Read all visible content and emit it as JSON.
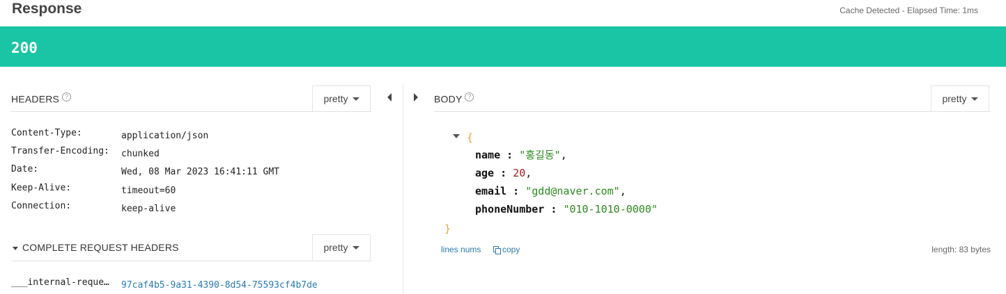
{
  "top": {
    "title": "Response",
    "cache_info": "Cache Detected - Elapsed Time: 1ms"
  },
  "status": {
    "code": "200",
    "color": "#19c5a4"
  },
  "headers_panel": {
    "title": "HEADERS",
    "help_icon": "?",
    "format_label": "pretty",
    "rows": [
      {
        "key": "Content-Type:",
        "value": "application/json"
      },
      {
        "key": "Transfer-Encoding:",
        "value": "chunked"
      },
      {
        "key": "Date:",
        "value": "Wed, 08 Mar 2023 16:41:11 GMT"
      },
      {
        "key": "Keep-Alive:",
        "value": "timeout=60"
      },
      {
        "key": "Connection:",
        "value": "keep-alive"
      }
    ]
  },
  "request_headers_panel": {
    "title": "COMPLETE REQUEST HEADERS",
    "format_label": "pretty",
    "rows": [
      {
        "key": "___internal-reque…",
        "value": "97caf4b5-9a31-4390-8d54-75593cf4b7de"
      }
    ]
  },
  "body_panel": {
    "title": "BODY",
    "help_icon": "?",
    "format_label": "pretty",
    "json": {
      "open_brace": "{",
      "close_brace": "}",
      "fields": [
        {
          "key": "name",
          "value": "\"홍길동\"",
          "kind": "string",
          "trail": ","
        },
        {
          "key": "age",
          "value": "20",
          "kind": "number",
          "trail": ","
        },
        {
          "key": "email",
          "value": "\"gdd@naver.com\"",
          "kind": "string",
          "trail": ","
        },
        {
          "key": "phoneNumber",
          "value": "\"010-1010-0000\"",
          "kind": "string",
          "trail": ""
        }
      ]
    },
    "footer": {
      "lines_nums": "lines nums",
      "copy": "copy",
      "length": "length: 83 bytes"
    }
  }
}
